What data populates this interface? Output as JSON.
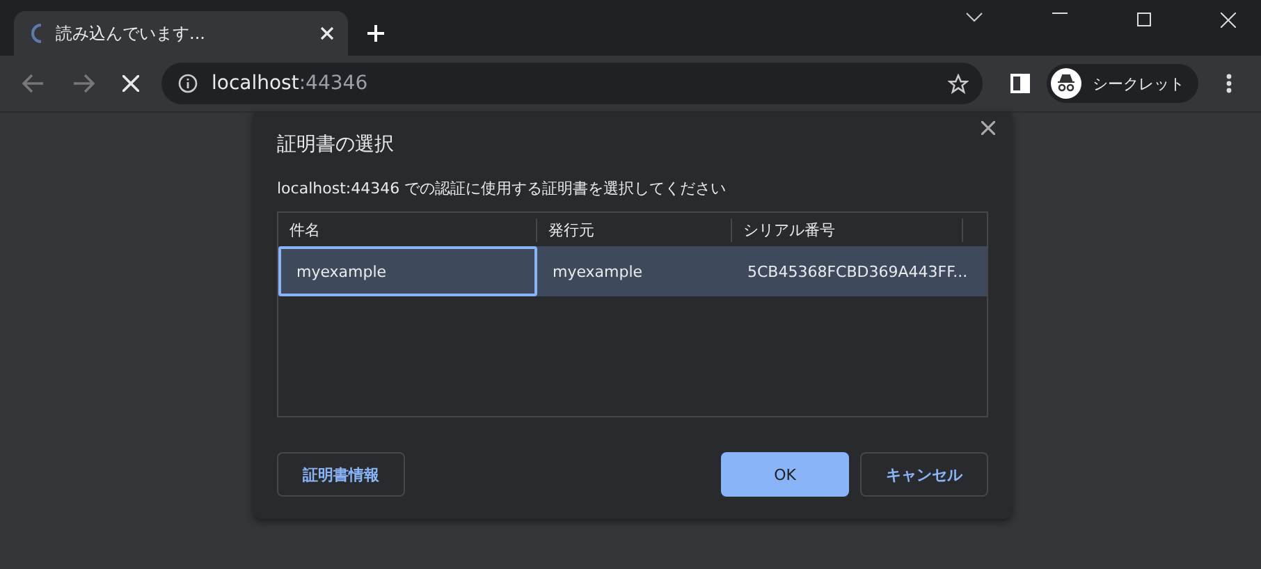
{
  "tab": {
    "title": "読み込んでいます...",
    "loading": true
  },
  "address": {
    "host": "localhost",
    "port": ":44346"
  },
  "profile": {
    "label": "シークレット"
  },
  "dialog": {
    "title": "証明書の選択",
    "message": "localhost:44346 での認証に使用する証明書を選択してください",
    "table": {
      "columns": [
        "件名",
        "発行元",
        "シリアル番号"
      ],
      "rows": [
        {
          "cells": [
            "myexample",
            "myexample",
            "5CB45368FCBD369A443FF..."
          ],
          "selected": true
        }
      ]
    },
    "buttons": [
      {
        "label": "証明書情報",
        "kind": "secondary"
      },
      {
        "label": "OK",
        "kind": "primary"
      },
      {
        "label": "キャンセル",
        "kind": "secondary"
      }
    ]
  }
}
